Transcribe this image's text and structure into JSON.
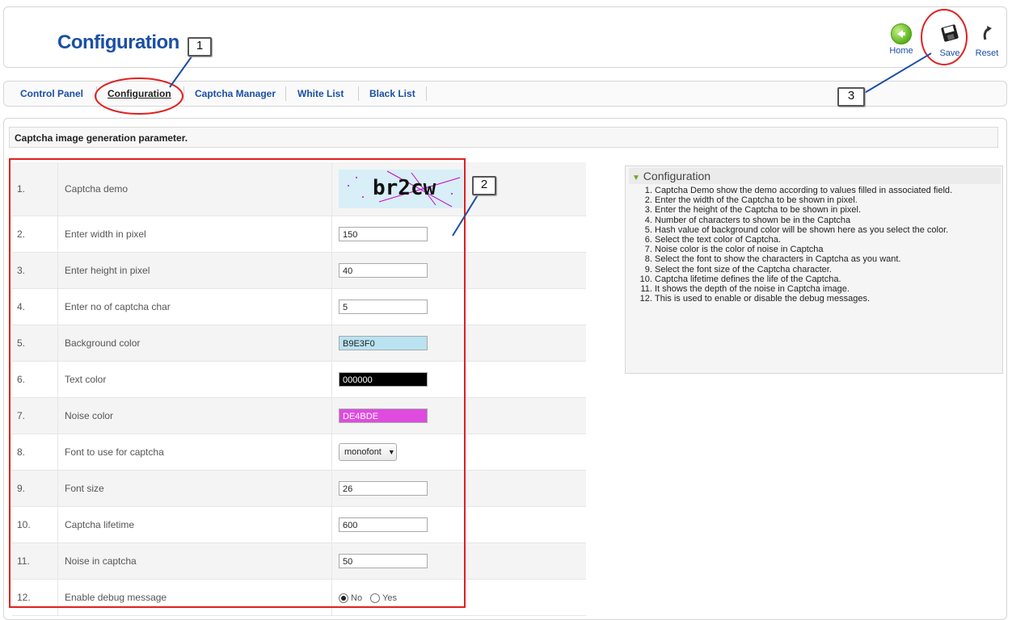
{
  "header": {
    "title": "Configuration",
    "toolbar": [
      {
        "label": "Home",
        "icon": "home-icon"
      },
      {
        "label": "Save",
        "icon": "save-icon"
      },
      {
        "label": "Reset",
        "icon": "reset-icon"
      }
    ]
  },
  "tabs": [
    {
      "label": "Control Panel",
      "active": false
    },
    {
      "label": "Configuration",
      "active": true
    },
    {
      "label": "Captcha Manager",
      "active": false
    },
    {
      "label": "White List",
      "active": false
    },
    {
      "label": "Black List",
      "active": false
    }
  ],
  "section_title": "Captcha image generation parameter.",
  "params": [
    {
      "num": "1.",
      "label": "Captcha demo",
      "captcha_text": "br2cw"
    },
    {
      "num": "2.",
      "label": "Enter width in pixel",
      "value": "150"
    },
    {
      "num": "3.",
      "label": "Enter height in pixel",
      "value": "40"
    },
    {
      "num": "4.",
      "label": "Enter no of captcha char",
      "value": "5"
    },
    {
      "num": "5.",
      "label": "Background color",
      "value": "B9E3F0",
      "bg": "#B9E3F0"
    },
    {
      "num": "6.",
      "label": "Text color",
      "value": "000000",
      "bg": "#000000"
    },
    {
      "num": "7.",
      "label": "Noise color",
      "value": "DE4BDE",
      "bg": "#DE4BDE"
    },
    {
      "num": "8.",
      "label": "Font to use for captcha",
      "selected": "monofont"
    },
    {
      "num": "9.",
      "label": "Font size",
      "value": "26"
    },
    {
      "num": "10.",
      "label": "Captcha lifetime",
      "value": "600"
    },
    {
      "num": "11.",
      "label": "Noise in captcha",
      "value": "50"
    },
    {
      "num": "12.",
      "label": "Enable debug message",
      "radio_no": "No",
      "radio_yes": "Yes"
    }
  ],
  "info": {
    "title": "Configuration",
    "items": [
      "Captcha Demo show the demo according to values filled in associated field.",
      "Enter the width of the Captcha to be shown in pixel.",
      "Enter the height of the Captcha to be shown in pixel.",
      "Number of characters to shown be in the Captcha",
      "Hash value of background color will be shown here as you select the color.",
      "Select the text color of Captcha.",
      "Noise color is the color of noise in Captcha",
      "Select the font to show the characters in Captcha as you want.",
      "Select the font size of the Captcha character.",
      "Captcha lifetime defines the life of the Captcha.",
      "It shows the depth of the noise in Captcha image.",
      "This is used to enable or disable the debug messages."
    ]
  },
  "annotations": [
    "1",
    "2",
    "3"
  ]
}
